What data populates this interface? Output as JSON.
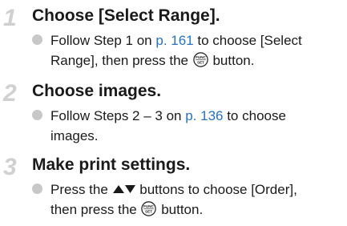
{
  "steps": [
    {
      "number": "1",
      "title": "Choose [Select Range].",
      "line1_pre": "Follow Step 1 on ",
      "link": "p. 161",
      "line1_post": " to choose [Select",
      "line2_pre": "Range], then press the ",
      "line2_post": " button."
    },
    {
      "number": "2",
      "title": "Choose images.",
      "line1_pre": "Follow Steps 2 – 3 on ",
      "link": "p. 136",
      "line1_post": " to choose",
      "line2": "images."
    },
    {
      "number": "3",
      "title": "Make print settings.",
      "line1_pre": "Press the ",
      "line1_post": " buttons to choose [Order],",
      "line2_pre": "then press the ",
      "line2_post": " button."
    }
  ],
  "icons": {
    "func_button": "func-set-button-icon",
    "up_down_arrows": "up-down-arrows-icon",
    "func_label_top": "FUNC",
    "func_label_bottom": "SET"
  },
  "colors": {
    "link": "#2672c4",
    "step_number": "#d0d0d0",
    "bullet": "#c8c8c8",
    "text": "#1a1a1a"
  }
}
